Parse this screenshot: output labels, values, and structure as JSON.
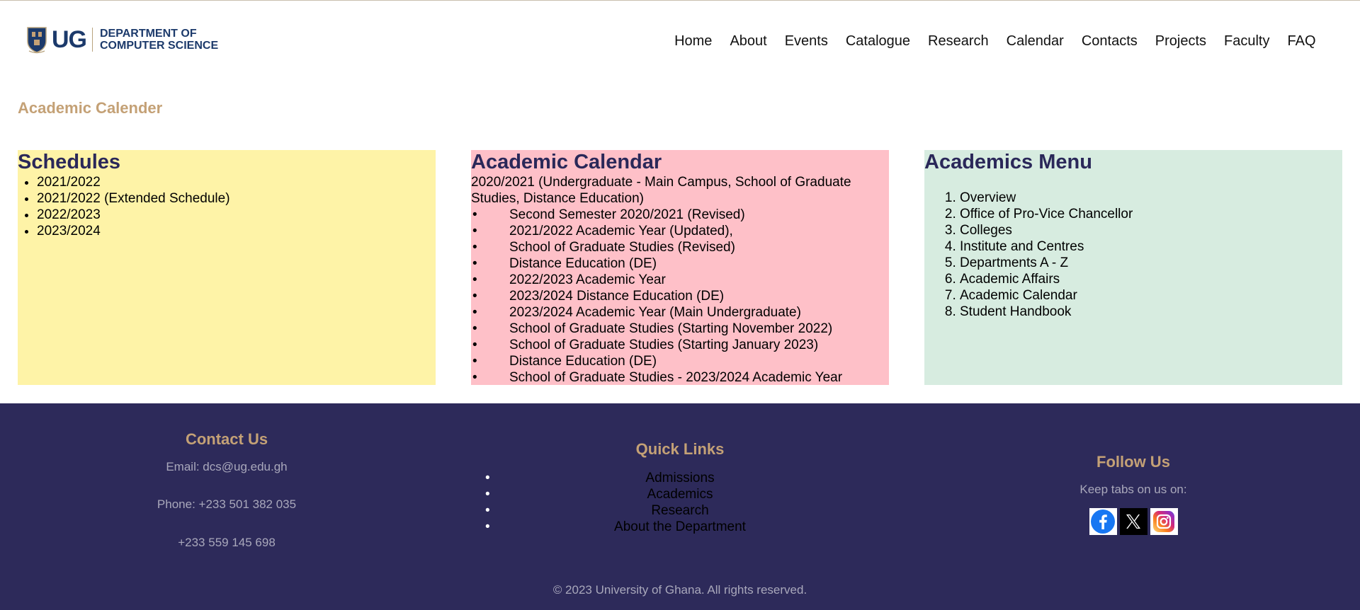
{
  "header": {
    "logo": {
      "abbr": "UG",
      "dept_line1": "DEPARTMENT OF",
      "dept_line2": "COMPUTER SCIENCE"
    },
    "nav": [
      "Home",
      "About",
      "Events",
      "Catalogue",
      "Research",
      "Calendar",
      "Contacts",
      "Projects",
      "Faculty",
      "FAQ"
    ]
  },
  "page_title": "Academic Calender",
  "schedules": {
    "title": "Schedules",
    "items": [
      "2021/2022",
      "2021/2022 (Extended Schedule)",
      "2022/2023",
      "2023/2024"
    ]
  },
  "academic_calendar": {
    "title": "Academic Calendar",
    "items": [
      "2020/2021 (Undergraduate - Main Campus, School of Graduate Studies, Distance Education)",
      "Second Semester 2020/2021 (Revised)",
      "2021/2022 Academic Year (Updated),",
      "School of Graduate Studies (Revised)",
      "Distance Education (DE)",
      "2022/2023 Academic Year",
      "2023/2024 Distance Education (DE)",
      "2023/2024 Academic Year (Main Undergraduate)",
      "School of Graduate Studies (Starting November 2022)",
      "School of Graduate Studies (Starting January 2023)",
      "Distance Education (DE)",
      "School of Graduate Studies - 2023/2024 Academic Year"
    ]
  },
  "academics_menu": {
    "title": "Academics Menu",
    "items": [
      "Overview",
      "Office of Pro-Vice Chancellor",
      "Colleges",
      "Institute and Centres",
      "Departments A - Z",
      "Academic Affairs",
      "Academic Calendar",
      "Student Handbook"
    ]
  },
  "footer": {
    "contact": {
      "title": "Contact Us",
      "email": "Email: dcs@ug.edu.gh",
      "phone1": "Phone: +233 501 382 035",
      "phone2": "+233 559 145 698"
    },
    "quick_links": {
      "title": "Quick Links",
      "items": [
        "Admissions",
        "Academics",
        "Research",
        "About the Department"
      ]
    },
    "follow": {
      "title": "Follow Us",
      "text": "Keep tabs on us on:",
      "socials": [
        "facebook-icon",
        "x-icon",
        "instagram-icon"
      ]
    },
    "copyright": "© 2023 University of Ghana. All rights reserved."
  },
  "colors": {
    "gold": "#c4a176",
    "navy": "#2d2a5a",
    "schedules_bg": "#fef3a7",
    "calendar_bg": "#fec0c8",
    "menu_bg": "#d7ece0"
  }
}
